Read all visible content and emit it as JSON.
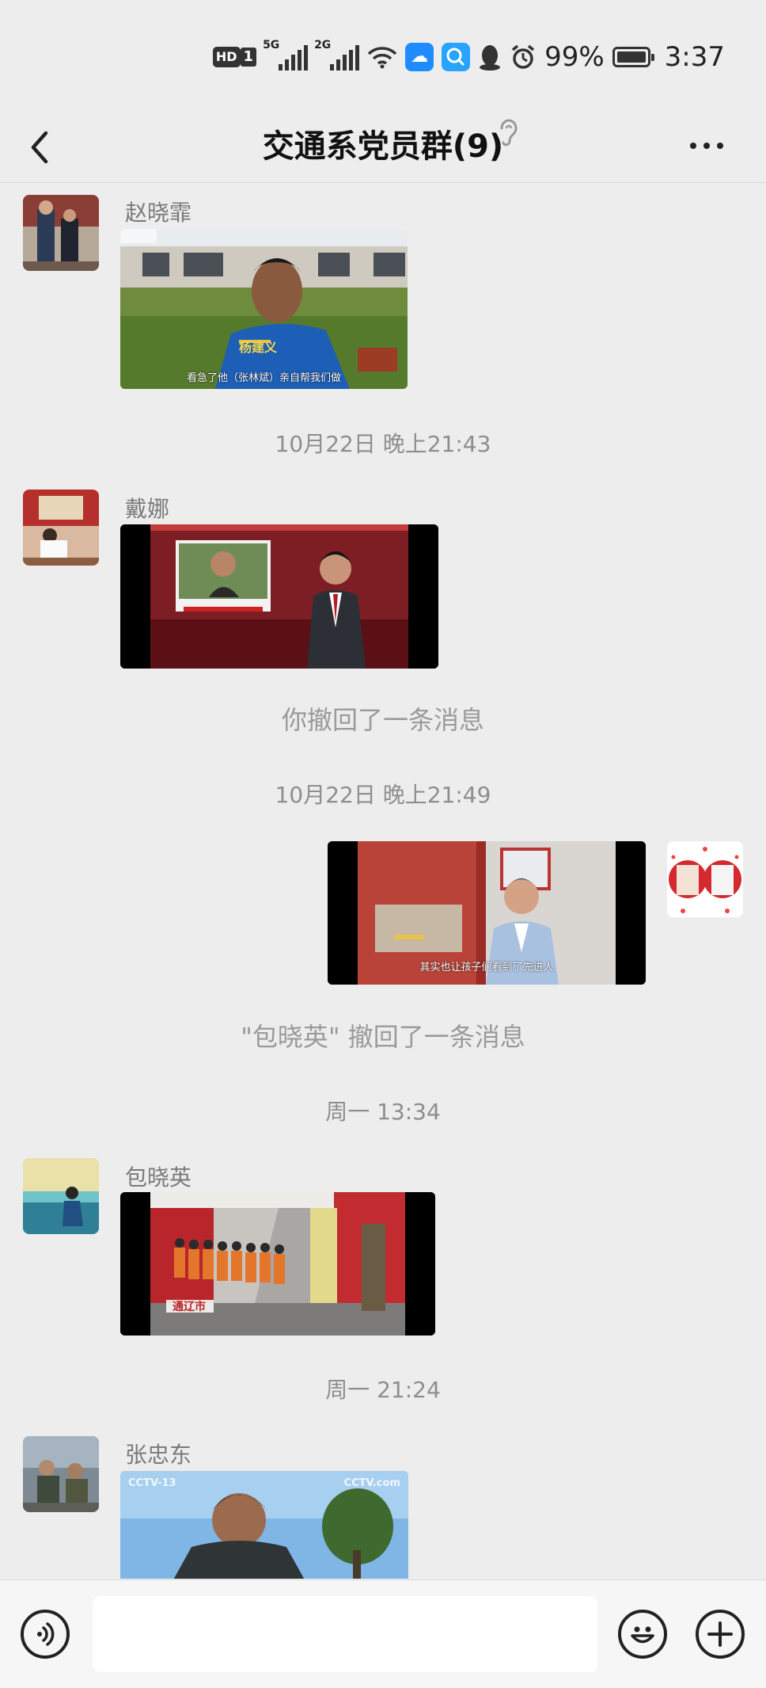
{
  "status_bar": {
    "hd": "HD",
    "sim": "1",
    "net1": "5G",
    "net2": "2G",
    "battery_percent": "99%",
    "time": "3:37",
    "icons": [
      "hd-icon",
      "signal-5g-icon",
      "signal-2g-icon",
      "wifi-icon",
      "weather-app-icon",
      "search-app-icon",
      "qq-icon",
      "alarm-icon",
      "battery-icon"
    ]
  },
  "header": {
    "title": "交通系党员群(9)",
    "icons": [
      "back-chevron-icon",
      "ear-mode-icon",
      "more-dots-icon"
    ]
  },
  "messages": [
    {
      "type": "video",
      "sender": "赵晓霏",
      "side": "left"
    },
    {
      "type": "time",
      "text": "10月22日 晚上21:43"
    },
    {
      "type": "video",
      "sender": "戴娜",
      "side": "left"
    },
    {
      "type": "system",
      "text": "你撤回了一条消息"
    },
    {
      "type": "time",
      "text": "10月22日 晚上21:49"
    },
    {
      "type": "video",
      "side": "right"
    },
    {
      "type": "system",
      "text": "\"包晓英\" 撤回了一条消息"
    },
    {
      "type": "time",
      "text": "周一 13:34"
    },
    {
      "type": "video",
      "sender": "包晓英",
      "side": "left"
    },
    {
      "type": "time",
      "text": "周一 21:24"
    },
    {
      "type": "video",
      "sender": "张忠东",
      "side": "left"
    }
  ],
  "labels": {
    "m1_sender": "赵晓霏",
    "m1_caption": "看急了他（张林斌）亲自帮我们做",
    "m1_name_tag": "杨建义",
    "t1": "10月22日 晚上21:43",
    "m2_sender": "戴娜",
    "sys1": "你撤回了一条消息",
    "t2": "10月22日 晚上21:49",
    "m3_caption": "其实也让孩子们看到了先进人",
    "sys2": "\"包晓英\" 撤回了一条消息",
    "t3": "周一 13:34",
    "m4_sender": "包晓英",
    "m4_tag": "通辽市",
    "t4": "周一 21:24",
    "m5_sender": "张忠东",
    "m5_logo_left": "CCTV-13",
    "m5_logo_right": "CCTV.com"
  },
  "input_bar": {
    "icons": [
      "voice-input-icon",
      "emoji-icon",
      "plus-icon"
    ],
    "text_value": ""
  },
  "colors": {
    "background": "#ededed",
    "system_text": "#8e8e8e",
    "sender_text": "#7a7a7a"
  }
}
